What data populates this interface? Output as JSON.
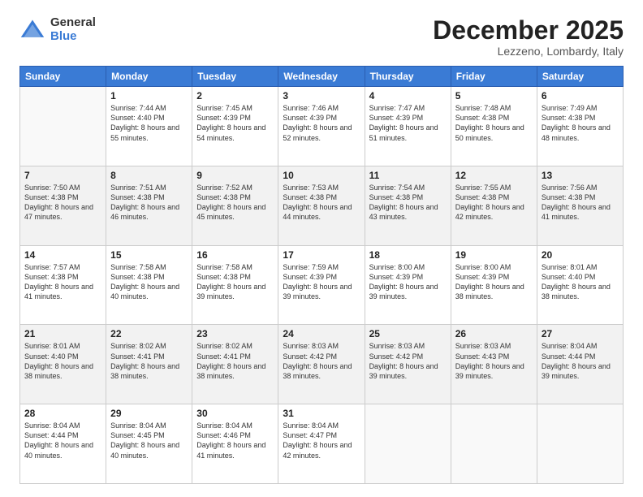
{
  "logo": {
    "general": "General",
    "blue": "Blue"
  },
  "title": "December 2025",
  "subtitle": "Lezzeno, Lombardy, Italy",
  "days_of_week": [
    "Sunday",
    "Monday",
    "Tuesday",
    "Wednesday",
    "Thursday",
    "Friday",
    "Saturday"
  ],
  "weeks": [
    [
      {
        "day": "",
        "empty": true
      },
      {
        "day": "1",
        "sunrise": "7:44 AM",
        "sunset": "4:40 PM",
        "daylight": "8 hours and 55 minutes."
      },
      {
        "day": "2",
        "sunrise": "7:45 AM",
        "sunset": "4:39 PM",
        "daylight": "8 hours and 54 minutes."
      },
      {
        "day": "3",
        "sunrise": "7:46 AM",
        "sunset": "4:39 PM",
        "daylight": "8 hours and 52 minutes."
      },
      {
        "day": "4",
        "sunrise": "7:47 AM",
        "sunset": "4:39 PM",
        "daylight": "8 hours and 51 minutes."
      },
      {
        "day": "5",
        "sunrise": "7:48 AM",
        "sunset": "4:38 PM",
        "daylight": "8 hours and 50 minutes."
      },
      {
        "day": "6",
        "sunrise": "7:49 AM",
        "sunset": "4:38 PM",
        "daylight": "8 hours and 48 minutes."
      }
    ],
    [
      {
        "day": "7",
        "sunrise": "7:50 AM",
        "sunset": "4:38 PM",
        "daylight": "8 hours and 47 minutes."
      },
      {
        "day": "8",
        "sunrise": "7:51 AM",
        "sunset": "4:38 PM",
        "daylight": "8 hours and 46 minutes."
      },
      {
        "day": "9",
        "sunrise": "7:52 AM",
        "sunset": "4:38 PM",
        "daylight": "8 hours and 45 minutes."
      },
      {
        "day": "10",
        "sunrise": "7:53 AM",
        "sunset": "4:38 PM",
        "daylight": "8 hours and 44 minutes."
      },
      {
        "day": "11",
        "sunrise": "7:54 AM",
        "sunset": "4:38 PM",
        "daylight": "8 hours and 43 minutes."
      },
      {
        "day": "12",
        "sunrise": "7:55 AM",
        "sunset": "4:38 PM",
        "daylight": "8 hours and 42 minutes."
      },
      {
        "day": "13",
        "sunrise": "7:56 AM",
        "sunset": "4:38 PM",
        "daylight": "8 hours and 41 minutes."
      }
    ],
    [
      {
        "day": "14",
        "sunrise": "7:57 AM",
        "sunset": "4:38 PM",
        "daylight": "8 hours and 41 minutes."
      },
      {
        "day": "15",
        "sunrise": "7:58 AM",
        "sunset": "4:38 PM",
        "daylight": "8 hours and 40 minutes."
      },
      {
        "day": "16",
        "sunrise": "7:58 AM",
        "sunset": "4:38 PM",
        "daylight": "8 hours and 39 minutes."
      },
      {
        "day": "17",
        "sunrise": "7:59 AM",
        "sunset": "4:39 PM",
        "daylight": "8 hours and 39 minutes."
      },
      {
        "day": "18",
        "sunrise": "8:00 AM",
        "sunset": "4:39 PM",
        "daylight": "8 hours and 39 minutes."
      },
      {
        "day": "19",
        "sunrise": "8:00 AM",
        "sunset": "4:39 PM",
        "daylight": "8 hours and 38 minutes."
      },
      {
        "day": "20",
        "sunrise": "8:01 AM",
        "sunset": "4:40 PM",
        "daylight": "8 hours and 38 minutes."
      }
    ],
    [
      {
        "day": "21",
        "sunrise": "8:01 AM",
        "sunset": "4:40 PM",
        "daylight": "8 hours and 38 minutes."
      },
      {
        "day": "22",
        "sunrise": "8:02 AM",
        "sunset": "4:41 PM",
        "daylight": "8 hours and 38 minutes."
      },
      {
        "day": "23",
        "sunrise": "8:02 AM",
        "sunset": "4:41 PM",
        "daylight": "8 hours and 38 minutes."
      },
      {
        "day": "24",
        "sunrise": "8:03 AM",
        "sunset": "4:42 PM",
        "daylight": "8 hours and 38 minutes."
      },
      {
        "day": "25",
        "sunrise": "8:03 AM",
        "sunset": "4:42 PM",
        "daylight": "8 hours and 39 minutes."
      },
      {
        "day": "26",
        "sunrise": "8:03 AM",
        "sunset": "4:43 PM",
        "daylight": "8 hours and 39 minutes."
      },
      {
        "day": "27",
        "sunrise": "8:04 AM",
        "sunset": "4:44 PM",
        "daylight": "8 hours and 39 minutes."
      }
    ],
    [
      {
        "day": "28",
        "sunrise": "8:04 AM",
        "sunset": "4:44 PM",
        "daylight": "8 hours and 40 minutes."
      },
      {
        "day": "29",
        "sunrise": "8:04 AM",
        "sunset": "4:45 PM",
        "daylight": "8 hours and 40 minutes."
      },
      {
        "day": "30",
        "sunrise": "8:04 AM",
        "sunset": "4:46 PM",
        "daylight": "8 hours and 41 minutes."
      },
      {
        "day": "31",
        "sunrise": "8:04 AM",
        "sunset": "4:47 PM",
        "daylight": "8 hours and 42 minutes."
      },
      {
        "day": "",
        "empty": true
      },
      {
        "day": "",
        "empty": true
      },
      {
        "day": "",
        "empty": true
      }
    ]
  ]
}
